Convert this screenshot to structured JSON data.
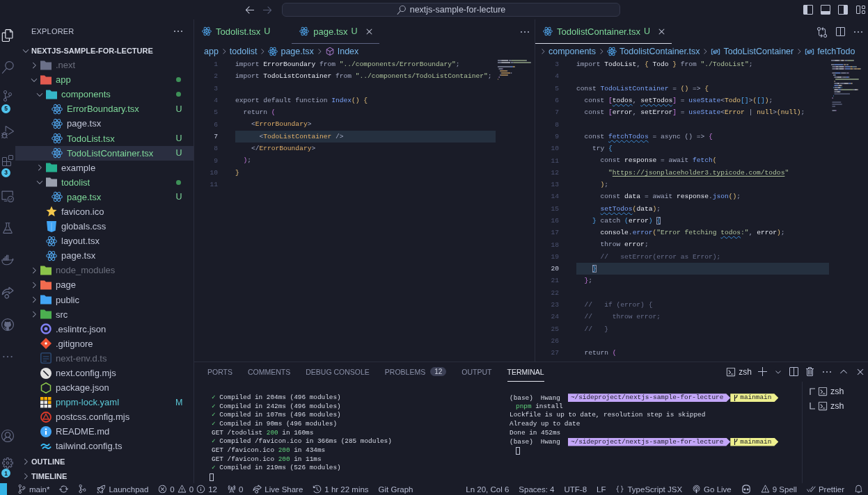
{
  "title_bar": {
    "navigation": {
      "back_enabled": true,
      "forward_enabled": false
    },
    "command_center": {
      "text": "nextjs-sample-for-lecture"
    }
  },
  "activity_bar": {
    "items": [
      {
        "kind": "explorer",
        "selected": true
      },
      {
        "kind": "search",
        "selected": false
      },
      {
        "kind": "source-control",
        "selected": false,
        "badge": "5"
      },
      {
        "kind": "run-debug",
        "selected": false
      },
      {
        "kind": "extensions",
        "selected": false,
        "badge": "3"
      },
      {
        "kind": "remote-explorer",
        "selected": false
      },
      {
        "kind": "testing",
        "selected": false
      },
      {
        "kind": "docker",
        "selected": false
      },
      {
        "kind": "live-share",
        "selected": false
      },
      {
        "kind": "github",
        "selected": false
      },
      {
        "kind": "more",
        "selected": false
      }
    ],
    "bottom_items": [
      {
        "kind": "accounts",
        "selected": false
      },
      {
        "kind": "manage",
        "selected": false,
        "badge": "1"
      }
    ]
  },
  "sidebar": {
    "title": "EXPLORER",
    "root": {
      "name": "NEXTJS-SAMPLE-FOR-LECTURE",
      "expanded": true
    },
    "tree": [
      {
        "name": ".next",
        "kind": "folder",
        "color": "#6b7089",
        "expanded": false,
        "untracked": false,
        "modified": false,
        "ignored": true,
        "changes_dot": false,
        "selected": false
      },
      {
        "name": "app",
        "kind": "folder",
        "color": "#e25a4f",
        "expanded": true,
        "untracked": true,
        "modified": false,
        "ignored": false,
        "changes_dot": true,
        "selected": false,
        "children": [
          {
            "name": "components",
            "kind": "folder",
            "color": "#35b6c8",
            "expanded": true,
            "untracked": true,
            "modified": false,
            "ignored": false,
            "changes_dot": true,
            "selected": false,
            "children": [
              {
                "name": "ErrorBoundary.tsx",
                "kind": "react",
                "untracked": true,
                "modified": false,
                "ignored": false,
                "badge": "U",
                "selected": false
              },
              {
                "name": "page.tsx",
                "kind": "react",
                "untracked": false,
                "modified": false,
                "ignored": false,
                "selected": false
              },
              {
                "name": "TodoList.tsx",
                "kind": "react",
                "untracked": true,
                "modified": false,
                "ignored": false,
                "badge": "U",
                "selected": false
              },
              {
                "name": "TodoListContainer.tsx",
                "kind": "react",
                "untracked": true,
                "modified": false,
                "ignored": false,
                "badge": "U",
                "selected": true
              }
            ]
          },
          {
            "name": "example",
            "kind": "folder",
            "color": "#26b08f",
            "expanded": false,
            "untracked": false,
            "modified": false,
            "ignored": false,
            "changes_dot": false,
            "selected": false
          },
          {
            "name": "todolist",
            "kind": "folder",
            "color": "#9aa0ae",
            "expanded": true,
            "untracked": true,
            "modified": false,
            "ignored": false,
            "changes_dot": true,
            "selected": false,
            "children": [
              {
                "name": "page.tsx",
                "kind": "react",
                "untracked": true,
                "modified": false,
                "ignored": false,
                "badge": "U",
                "selected": false
              }
            ]
          },
          {
            "name": "favicon.ico",
            "kind": "favicon",
            "untracked": false,
            "modified": false,
            "ignored": false,
            "selected": false
          },
          {
            "name": "globals.css",
            "kind": "css",
            "untracked": false,
            "modified": false,
            "ignored": false,
            "selected": false
          },
          {
            "name": "layout.tsx",
            "kind": "react",
            "untracked": false,
            "modified": false,
            "ignored": false,
            "selected": false
          },
          {
            "name": "page.tsx",
            "kind": "react",
            "untracked": false,
            "modified": false,
            "ignored": false,
            "selected": false
          }
        ]
      },
      {
        "name": "node_modules",
        "kind": "folder",
        "color": "#8bc34a",
        "expanded": false,
        "untracked": false,
        "modified": false,
        "ignored": true,
        "changes_dot": false,
        "selected": false
      },
      {
        "name": "page",
        "kind": "folder",
        "color": "#f26b4f",
        "expanded": false,
        "untracked": false,
        "modified": false,
        "ignored": false,
        "changes_dot": false,
        "selected": false
      },
      {
        "name": "public",
        "kind": "folder",
        "color": "#42a5f5",
        "expanded": false,
        "untracked": false,
        "modified": false,
        "ignored": false,
        "changes_dot": false,
        "selected": false
      },
      {
        "name": "src",
        "kind": "folder",
        "color": "#4caf50",
        "expanded": false,
        "untracked": false,
        "modified": false,
        "ignored": false,
        "changes_dot": false,
        "selected": false
      },
      {
        "name": ".eslintrc.json",
        "kind": "eslint",
        "untracked": false,
        "modified": false,
        "ignored": false,
        "selected": false
      },
      {
        "name": ".gitignore",
        "kind": "git",
        "untracked": false,
        "modified": false,
        "ignored": false,
        "selected": false
      },
      {
        "name": "next-env.d.ts",
        "kind": "typescript",
        "untracked": false,
        "modified": false,
        "ignored": true,
        "selected": false
      },
      {
        "name": "next.config.mjs",
        "kind": "next",
        "untracked": false,
        "modified": false,
        "ignored": false,
        "selected": false
      },
      {
        "name": "package.json",
        "kind": "node",
        "untracked": false,
        "modified": false,
        "ignored": false,
        "selected": false
      },
      {
        "name": "pnpm-lock.yaml",
        "kind": "pnpm",
        "untracked": false,
        "modified": true,
        "ignored": false,
        "badge": "M",
        "selected": false
      },
      {
        "name": "postcss.config.mjs",
        "kind": "postcss",
        "untracked": false,
        "modified": false,
        "ignored": false,
        "selected": false
      },
      {
        "name": "README.md",
        "kind": "info",
        "untracked": false,
        "modified": false,
        "ignored": false,
        "selected": false
      },
      {
        "name": "tailwind.config.ts",
        "kind": "tailwind",
        "untracked": false,
        "modified": false,
        "ignored": false,
        "selected": false
      }
    ],
    "sections": [
      {
        "title": "OUTLINE",
        "expanded": false
      },
      {
        "title": "TIMELINE",
        "expanded": false
      }
    ]
  },
  "editor_groups": [
    {
      "focused": false,
      "tabs": [
        {
          "name": "Todolist.tsx",
          "badge": "U",
          "untracked": true,
          "selected": false
        },
        {
          "name": "page.tsx",
          "badge": "U",
          "untracked": true,
          "selected": true
        }
      ],
      "actions": [
        {
          "kind": "more"
        }
      ],
      "breadcrumb_truncated": false,
      "breadcrumb": [
        {
          "text": "app",
          "kind": "folder"
        },
        {
          "text": "todolist",
          "kind": "folder"
        },
        {
          "text": "page.tsx",
          "kind": "react"
        },
        {
          "text": "Index",
          "kind": "function"
        }
      ],
      "lines": [
        {
          "number": "1",
          "current": false,
          "tokens": [
            {
              "text": "import ",
              "kind": "keyword"
            },
            {
              "text": "ErrorBoundary",
              "kind": "name"
            },
            {
              "text": " from ",
              "kind": "keyword"
            },
            {
              "text": "\"../components/ErrorBoundary\"",
              "kind": "string"
            },
            {
              "text": ";",
              "kind": "punct"
            }
          ]
        },
        {
          "number": "2",
          "current": false,
          "tokens": [
            {
              "text": "import ",
              "kind": "keyword"
            },
            {
              "text": "TodoListContainer",
              "kind": "name"
            },
            {
              "text": " from ",
              "kind": "keyword"
            },
            {
              "text": "\"../components/TodoListContainer\"",
              "kind": "string"
            },
            {
              "text": ";",
              "kind": "punct"
            }
          ]
        },
        {
          "number": "3",
          "current": false
        },
        {
          "number": "4",
          "current": false,
          "tokens": [
            {
              "text": "export default function ",
              "kind": "keyword"
            },
            {
              "text": "Index",
              "kind": "function"
            },
            {
              "text": "() {",
              "kind": "bracket-gold"
            }
          ]
        },
        {
          "number": "5",
          "current": false,
          "tokens": [
            {
              "text": "  return ",
              "kind": "keyword"
            },
            {
              "text": "(",
              "kind": "bracket-pink"
            }
          ]
        },
        {
          "number": "6",
          "current": false,
          "tokens": [
            {
              "text": "    <",
              "kind": "punct"
            },
            {
              "text": "ErrorBoundary",
              "kind": "tag"
            },
            {
              "text": ">",
              "kind": "punct"
            }
          ]
        },
        {
          "number": "7",
          "current": true,
          "tokens": [
            {
              "text": "      <",
              "kind": "punct"
            },
            {
              "text": "TodoListContainer",
              "kind": "tag"
            },
            {
              "text": " />",
              "kind": "punct"
            }
          ]
        },
        {
          "number": "8",
          "current": false,
          "tokens": [
            {
              "text": "    </",
              "kind": "punct"
            },
            {
              "text": "ErrorBoundary",
              "kind": "tag"
            },
            {
              "text": ">",
              "kind": "punct"
            }
          ]
        },
        {
          "number": "9",
          "current": false,
          "tokens": [
            {
              "text": "  )",
              "kind": "bracket-pink"
            },
            {
              "text": ";",
              "kind": "punct"
            }
          ]
        },
        {
          "number": "10",
          "current": false,
          "tokens": [
            {
              "text": "}",
              "kind": "bracket-gold"
            }
          ]
        },
        {
          "number": "11",
          "current": false
        }
      ]
    },
    {
      "focused": true,
      "tabs": [
        {
          "name": "TodolistContainer.tsx",
          "badge": "U",
          "untracked": true,
          "selected": true
        }
      ],
      "actions": [
        {
          "kind": "compare"
        },
        {
          "kind": "split"
        },
        {
          "kind": "more"
        }
      ],
      "breadcrumb_truncated": true,
      "breadcrumb": [
        {
          "text": "components",
          "kind": "folder"
        },
        {
          "text": "TodolistContainer.tsx",
          "kind": "react"
        },
        {
          "text": "TodoListContainer",
          "kind": "variable"
        },
        {
          "text": "fetchTodo",
          "kind": "variable"
        }
      ],
      "lines": [
        {
          "number": "3",
          "current": false,
          "tokens": [
            {
              "text": "import ",
              "kind": "keyword"
            },
            {
              "text": "TodoList",
              "kind": "name"
            },
            {
              "text": ", ",
              "kind": "punct"
            },
            {
              "text": "{",
              "kind": "bracket-gold"
            },
            {
              "text": " Todo ",
              "kind": "name"
            },
            {
              "text": "}",
              "kind": "bracket-gold"
            },
            {
              "text": " from ",
              "kind": "keyword"
            },
            {
              "text": "\"./TodoList\"",
              "kind": "string"
            },
            {
              "text": ";",
              "kind": "punct"
            }
          ]
        },
        {
          "number": "4",
          "current": false
        },
        {
          "number": "5",
          "current": false,
          "tokens": [
            {
              "text": "const ",
              "kind": "keyword"
            },
            {
              "text": "TodoListContainer",
              "kind": "function"
            },
            {
              "text": " = ",
              "kind": "punct"
            },
            {
              "text": "()",
              "kind": "bracket-gold"
            },
            {
              "text": " => ",
              "kind": "punct"
            },
            {
              "text": "{",
              "kind": "bracket-gold"
            }
          ]
        },
        {
          "number": "6",
          "current": false,
          "tokens": [
            {
              "text": "  const ",
              "kind": "keyword"
            },
            {
              "text": "[",
              "kind": "bracket-pink"
            },
            {
              "text": "todos",
              "kind": "name",
              "squiggle": true
            },
            {
              "text": ", ",
              "kind": "punct"
            },
            {
              "text": "setTodos",
              "kind": "name",
              "squiggle": true
            },
            {
              "text": "]",
              "kind": "bracket-pink"
            },
            {
              "text": " = ",
              "kind": "punct"
            },
            {
              "text": "useState",
              "kind": "function"
            },
            {
              "text": "<",
              "kind": "punct"
            },
            {
              "text": "Todo",
              "kind": "type"
            },
            {
              "text": "[]",
              "kind": "bracket-blue"
            },
            {
              "text": ">",
              "kind": "punct"
            },
            {
              "text": "(",
              "kind": "bracket-gold"
            },
            {
              "text": "[]",
              "kind": "bracket-blue"
            },
            {
              "text": ")",
              "kind": "bracket-gold"
            },
            {
              "text": ";",
              "kind": "punct"
            }
          ]
        },
        {
          "number": "7",
          "current": false,
          "tokens": [
            {
              "text": "  const ",
              "kind": "keyword"
            },
            {
              "text": "[",
              "kind": "bracket-pink"
            },
            {
              "text": "error",
              "kind": "name"
            },
            {
              "text": ", ",
              "kind": "punct"
            },
            {
              "text": "setError",
              "kind": "name"
            },
            {
              "text": "]",
              "kind": "bracket-pink"
            },
            {
              "text": " = ",
              "kind": "punct"
            },
            {
              "text": "useState",
              "kind": "function"
            },
            {
              "text": "<",
              "kind": "punct"
            },
            {
              "text": "Error",
              "kind": "type"
            },
            {
              "text": " | ",
              "kind": "punct"
            },
            {
              "text": "null",
              "kind": "type"
            },
            {
              "text": ">",
              "kind": "punct"
            },
            {
              "text": "(",
              "kind": "bracket-gold"
            },
            {
              "text": "null",
              "kind": "type"
            },
            {
              "text": ")",
              "kind": "bracket-gold"
            },
            {
              "text": ";",
              "kind": "punct"
            }
          ]
        },
        {
          "number": "8",
          "current": false
        },
        {
          "number": "9",
          "current": false,
          "tokens": [
            {
              "text": "  const ",
              "kind": "keyword"
            },
            {
              "text": "fetchTodos",
              "kind": "function",
              "squiggle": true
            },
            {
              "text": " = ",
              "kind": "punct"
            },
            {
              "text": "async ",
              "kind": "keyword"
            },
            {
              "text": "()",
              "kind": "keyword"
            },
            {
              "text": " => ",
              "kind": "punct"
            },
            {
              "text": "{",
              "kind": "bracket-pink"
            }
          ]
        },
        {
          "number": "10",
          "current": false,
          "tokens": [
            {
              "text": "    try ",
              "kind": "keyword"
            },
            {
              "text": "{",
              "kind": "bracket-blue"
            }
          ]
        },
        {
          "number": "11",
          "current": false,
          "tokens": [
            {
              "text": "      const ",
              "kind": "keyword"
            },
            {
              "text": "response",
              "kind": "name"
            },
            {
              "text": " = ",
              "kind": "punct"
            },
            {
              "text": "await ",
              "kind": "keyword"
            },
            {
              "text": "fetch",
              "kind": "function"
            },
            {
              "text": "(",
              "kind": "bracket-gold"
            }
          ]
        },
        {
          "number": "12",
          "current": false,
          "tokens": [
            {
              "text": "        \"",
              "kind": "string"
            },
            {
              "text": "https://jsonplaceholder3.typicode.com/todos",
              "kind": "link"
            },
            {
              "text": "\"",
              "kind": "string"
            }
          ]
        },
        {
          "number": "13",
          "current": false,
          "tokens": [
            {
              "text": "      )",
              "kind": "bracket-gold"
            },
            {
              "text": ";",
              "kind": "punct"
            }
          ]
        },
        {
          "number": "14",
          "current": false,
          "tokens": [
            {
              "text": "      const ",
              "kind": "keyword"
            },
            {
              "text": "data",
              "kind": "name"
            },
            {
              "text": " = ",
              "kind": "punct"
            },
            {
              "text": "await ",
              "kind": "keyword"
            },
            {
              "text": "response",
              "kind": "name"
            },
            {
              "text": ".",
              "kind": "punct"
            },
            {
              "text": "json",
              "kind": "function"
            },
            {
              "text": "()",
              "kind": "bracket-gold"
            },
            {
              "text": ";",
              "kind": "punct"
            }
          ]
        },
        {
          "number": "15",
          "current": false,
          "tokens": [
            {
              "text": "      setTodos",
              "kind": "function",
              "squiggle": true
            },
            {
              "text": "(",
              "kind": "bracket-gold"
            },
            {
              "text": "data",
              "kind": "name"
            },
            {
              "text": ")",
              "kind": "bracket-gold"
            },
            {
              "text": ";",
              "kind": "punct"
            }
          ]
        },
        {
          "number": "16",
          "current": false,
          "tokens": [
            {
              "text": "    }",
              "kind": "bracket-blue"
            },
            {
              "text": " catch ",
              "kind": "keyword"
            },
            {
              "text": "(",
              "kind": "bracket-blue"
            },
            {
              "text": "error",
              "kind": "name"
            },
            {
              "text": ")",
              "kind": "bracket-blue"
            },
            {
              "text": " {",
              "kind": "bracket-blue",
              "bracket_match": true
            }
          ]
        },
        {
          "number": "17",
          "current": false,
          "tokens": [
            {
              "text": "      console",
              "kind": "name"
            },
            {
              "text": ".",
              "kind": "punct"
            },
            {
              "text": "error",
              "kind": "function"
            },
            {
              "text": "(",
              "kind": "bracket-gold"
            },
            {
              "text": "\"Error fetching ",
              "kind": "string"
            },
            {
              "text": "todos",
              "kind": "string",
              "squiggle": true
            },
            {
              "text": ":\"",
              "kind": "string"
            },
            {
              "text": ", ",
              "kind": "punct"
            },
            {
              "text": "error",
              "kind": "name"
            },
            {
              "text": ")",
              "kind": "bracket-gold"
            },
            {
              "text": ";",
              "kind": "punct"
            }
          ]
        },
        {
          "number": "18",
          "current": false,
          "tokens": [
            {
              "text": "      throw ",
              "kind": "keyword"
            },
            {
              "text": "error",
              "kind": "name"
            },
            {
              "text": ";",
              "kind": "punct"
            }
          ]
        },
        {
          "number": "19",
          "current": false,
          "tokens": [
            {
              "text": "      //   setError(error as Error);",
              "kind": "comment"
            }
          ]
        },
        {
          "number": "20",
          "current": true,
          "tokens": [
            {
              "text": "    }",
              "kind": "bracket-blue",
              "bracket_match": true
            }
          ]
        },
        {
          "number": "21",
          "current": false,
          "tokens": [
            {
              "text": "  }",
              "kind": "bracket-pink"
            },
            {
              "text": ";",
              "kind": "punct"
            }
          ]
        },
        {
          "number": "22",
          "current": false
        },
        {
          "number": "23",
          "current": false,
          "tokens": [
            {
              "text": "  //   if (error) {",
              "kind": "comment"
            }
          ]
        },
        {
          "number": "24",
          "current": false,
          "tokens": [
            {
              "text": "  //     throw error;",
              "kind": "comment"
            }
          ]
        },
        {
          "number": "25",
          "current": false,
          "tokens": [
            {
              "text": "  //   }",
              "kind": "comment"
            }
          ]
        },
        {
          "number": "26",
          "current": false
        },
        {
          "number": "27",
          "current": false,
          "tokens": [
            {
              "text": "  return ",
              "kind": "keyword"
            },
            {
              "text": "(",
              "kind": "bracket-pink"
            }
          ]
        }
      ]
    }
  ],
  "panel": {
    "tabs": [
      {
        "label": "PORTS",
        "selected": false
      },
      {
        "label": "COMMENTS",
        "selected": false
      },
      {
        "label": "DEBUG CONSOLE",
        "selected": false
      },
      {
        "label": "PROBLEMS",
        "selected": false,
        "count": "12"
      },
      {
        "label": "OUTPUT",
        "selected": false
      },
      {
        "label": "TERMINAL",
        "selected": true
      }
    ],
    "shell": "zsh",
    "terminals": [
      {
        "cursor": true,
        "lines": [
          {
            "kind": "output",
            "segments": [
              {
                "text": "✓",
                "kind": "success"
              },
              {
                "text": " Compiled in 204ms (496 modules)",
                "kind": "plain"
              }
            ]
          },
          {
            "kind": "output",
            "segments": [
              {
                "text": "✓",
                "kind": "success"
              },
              {
                "text": " Compiled in 242ms (496 modules)",
                "kind": "plain"
              }
            ]
          },
          {
            "kind": "output",
            "segments": [
              {
                "text": "✓",
                "kind": "success"
              },
              {
                "text": " Compiled in 107ms (496 modules)",
                "kind": "plain"
              }
            ]
          },
          {
            "kind": "output",
            "segments": [
              {
                "text": "✓",
                "kind": "success"
              },
              {
                "text": " Compiled in 90ms (496 modules)",
                "kind": "plain"
              }
            ]
          },
          {
            "kind": "output",
            "segments": [
              {
                "text": "GET /todolist ",
                "kind": "plain"
              },
              {
                "text": "200",
                "kind": "success"
              },
              {
                "text": " in 160ms",
                "kind": "plain"
              }
            ]
          },
          {
            "kind": "output",
            "segments": [
              {
                "text": "✓",
                "kind": "success"
              },
              {
                "text": " Compiled /favicon.ico in 366ms (285 modules)",
                "kind": "plain"
              }
            ]
          },
          {
            "kind": "output",
            "segments": [
              {
                "text": "GET /favicon.ico ",
                "kind": "plain"
              },
              {
                "text": "200",
                "kind": "success"
              },
              {
                "text": " in 434ms",
                "kind": "plain"
              }
            ]
          },
          {
            "kind": "output",
            "segments": [
              {
                "text": "GET /favicon.ico ",
                "kind": "plain"
              },
              {
                "text": "200",
                "kind": "success"
              },
              {
                "text": " in 11ms",
                "kind": "plain"
              }
            ]
          },
          {
            "kind": "output",
            "segments": [
              {
                "text": "✓",
                "kind": "success"
              },
              {
                "text": " Compiled in 219ms (526 modules)",
                "kind": "plain"
              }
            ]
          }
        ]
      },
      {
        "cursor": true,
        "lines": [
          {
            "kind": "prompt",
            "env": "(base)",
            "user": "Hwang",
            "path": "~/sideproject/nextjs-sample-for-lecture",
            "branch": "mainmain"
          },
          {
            "kind": "command",
            "segments": [
              {
                "text": "pnpm",
                "kind": "success"
              },
              {
                "text": " install",
                "kind": "plain"
              }
            ]
          },
          {
            "kind": "output",
            "segments": [
              {
                "text": "Lockfile is up to date, resolution step is skipped",
                "kind": "plain"
              }
            ]
          },
          {
            "kind": "output",
            "segments": [
              {
                "text": "Already up to date",
                "kind": "plain"
              }
            ]
          },
          {
            "kind": "output",
            "segments": [
              {
                "text": "Done in 452ms",
                "kind": "plain"
              }
            ]
          },
          {
            "kind": "prompt",
            "env": "(base)",
            "user": "Hwang",
            "path": "~/sideproject/nextjs-sample-for-lecture",
            "branch": "mainmain"
          }
        ]
      }
    ],
    "terminal_list": [
      {
        "name": "zsh",
        "selected": false
      },
      {
        "name": "zsh",
        "selected": false
      }
    ]
  },
  "status_bar": {
    "left_items": [
      {
        "kind": "remote"
      },
      {
        "kind": "branch",
        "text": "main*"
      },
      {
        "kind": "sync"
      },
      {
        "kind": "graph"
      },
      {
        "kind": "launchpad",
        "text": "Launchpad"
      },
      {
        "kind": "problems",
        "errors": "0",
        "warnings": "0",
        "infos": "12"
      },
      {
        "kind": "ports",
        "text": "0"
      },
      {
        "kind": "live-share",
        "text": "Live Share"
      },
      {
        "kind": "timer",
        "text": "1 hr 22 mins"
      },
      {
        "kind": "plain",
        "text": "Git Graph"
      }
    ],
    "right_items": [
      {
        "kind": "plain",
        "text": "Ln 20, Col 6"
      },
      {
        "kind": "plain",
        "text": "Spaces: 4"
      },
      {
        "kind": "plain",
        "text": "UTF-8"
      },
      {
        "kind": "plain",
        "text": "LF"
      },
      {
        "kind": "language",
        "text": "TypeScript JSX"
      },
      {
        "kind": "go-live",
        "text": "Go Live"
      },
      {
        "kind": "copilot"
      },
      {
        "kind": "spell",
        "text": "9 Spell"
      },
      {
        "kind": "prettier",
        "text": "Prettier"
      },
      {
        "kind": "notifications"
      }
    ]
  }
}
